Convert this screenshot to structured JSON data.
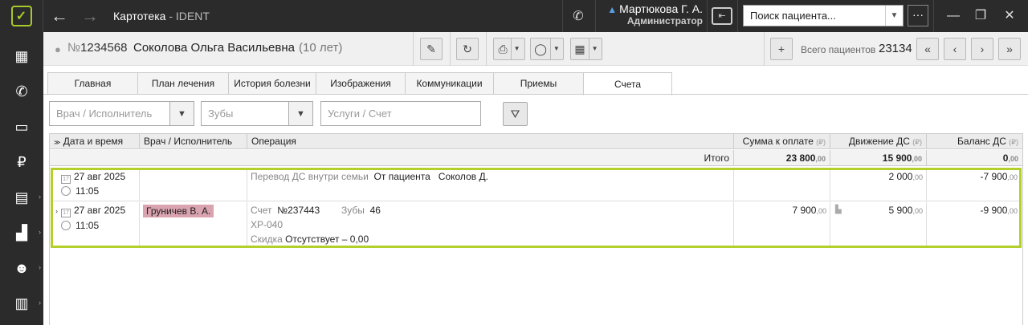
{
  "titlebar": {
    "title": "Картотека",
    "subtitle": "- IDENT",
    "user_name": "Мартюкова Г. А.",
    "user_role": "Администратор",
    "search_placeholder": "Поиск пациента...",
    "more_label": "···"
  },
  "sidebar": {
    "items": [
      {
        "icon": "calendar-grid-icon"
      },
      {
        "icon": "phone-incoming-icon"
      },
      {
        "icon": "chat-icon"
      },
      {
        "icon": "ruble-icon"
      },
      {
        "icon": "schedule-icon"
      },
      {
        "icon": "chart-icon"
      },
      {
        "icon": "people-icon"
      },
      {
        "icon": "clipboard-icon"
      }
    ]
  },
  "patient": {
    "card_prefix": "№",
    "card_number": "1234568",
    "name": "Соколова Ольга Васильевна",
    "age": "(10 лет)",
    "total_label": "Всего пациентов",
    "total_value": "23134"
  },
  "tabs": [
    {
      "label": "Главная"
    },
    {
      "label": "План лечения"
    },
    {
      "label": "История болезни"
    },
    {
      "label": "Изображения"
    },
    {
      "label": "Коммуникации"
    },
    {
      "label": "Приемы"
    },
    {
      "label": "Счета"
    }
  ],
  "filters": {
    "doctor_placeholder": "Врач / Исполнитель",
    "teeth_placeholder": "Зубы",
    "services_placeholder": "Услуги / Счет"
  },
  "grid": {
    "headers": {
      "date": "Дата и время",
      "doctor": "Врач / Исполнитель",
      "operation": "Операция",
      "sum": "Сумма к оплате",
      "movement": "Движение ДС",
      "balance": "Баланс ДС",
      "currency": "(₽)"
    },
    "total": {
      "label": "Итого",
      "sum": "23 800",
      "sum_kop": ",00",
      "movement": "15 900",
      "movement_kop": ",00",
      "balance": "0",
      "balance_kop": ",00"
    },
    "rows": [
      {
        "date": "27 авг 2025",
        "time": "11:05",
        "op_label": "Перевод ДС внутри семьи",
        "op_from": "От пациента",
        "op_person": "Соколов Д.",
        "movement": "2 000",
        "movement_kop": ",00",
        "balance": "-7 900",
        "balance_kop": ",00"
      },
      {
        "date": "27 авг 2025",
        "time": "11:05",
        "doctor": "Груничев В. А.",
        "invoice_label": "Счет",
        "invoice_no": "№237443",
        "teeth_label": "Зубы",
        "teeth": "46",
        "code": "ХР-040",
        "discount_label": "Скидка",
        "discount_value": "Отсутствует – 0,00",
        "sum": "7 900",
        "sum_kop": ",00",
        "movement": "5 900",
        "movement_kop": ",00",
        "balance": "-9 900",
        "balance_kop": ",00"
      }
    ]
  },
  "colors": {
    "titlebar_bg": "#2b2b2b",
    "accent": "#a6c92b",
    "selection_frame": "#b3cf2b",
    "doctor_tag": "#d9a3b0"
  }
}
